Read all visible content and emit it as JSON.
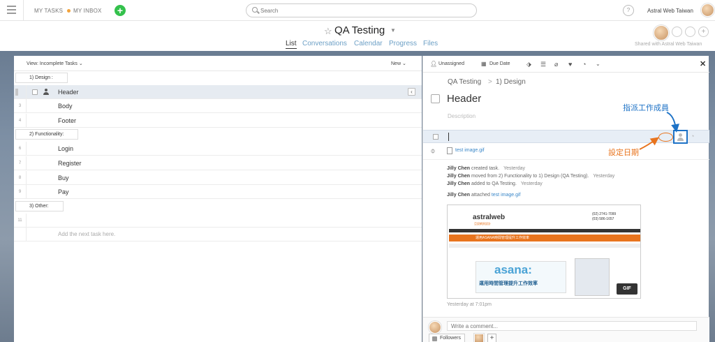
{
  "topbar": {
    "my_tasks": "MY TASKS",
    "my_inbox": "MY INBOX",
    "search_placeholder": "Search",
    "help": "?",
    "workspace": "Astral Web Taiwan"
  },
  "project": {
    "title": "QA Testing",
    "tabs": [
      {
        "label": "List",
        "active": true
      },
      {
        "label": "Conversations",
        "active": false
      },
      {
        "label": "Calendar",
        "active": false
      },
      {
        "label": "Progress",
        "active": false
      },
      {
        "label": "Files",
        "active": false
      }
    ],
    "shared_with": "Shared with Astral Web Taiwan"
  },
  "list": {
    "view_label": "View: Incomplete Tasks",
    "new_label": "New",
    "rows": [
      {
        "type": "section",
        "num": "",
        "text": "1) Design :"
      },
      {
        "type": "task",
        "num": "",
        "text": "Header",
        "selected": true
      },
      {
        "type": "task",
        "num": "3",
        "text": "Body"
      },
      {
        "type": "task",
        "num": "4",
        "text": "Footer"
      },
      {
        "type": "section",
        "num": "",
        "text": "2) Functionality:"
      },
      {
        "type": "task",
        "num": "6",
        "text": "Login"
      },
      {
        "type": "task",
        "num": "7",
        "text": "Register"
      },
      {
        "type": "task",
        "num": "8",
        "text": "Buy"
      },
      {
        "type": "task",
        "num": "9",
        "text": "Pay"
      },
      {
        "type": "section",
        "num": "",
        "text": "3) Other:"
      },
      {
        "type": "task",
        "num": "11",
        "text": ""
      },
      {
        "type": "add",
        "num": "",
        "text": "Add the next task here."
      }
    ]
  },
  "detail": {
    "toolbar": {
      "assignee": "Unassigned",
      "due_date": "Due Date"
    },
    "breadcrumb": {
      "project": "QA Testing",
      "sep": ">",
      "section": "1) Design"
    },
    "task_title": "Header",
    "description_placeholder": "Description",
    "attachment": "test image.gif",
    "stories": [
      {
        "author": "Jilly Chen",
        "text": "created task.",
        "time": "Yesterday"
      },
      {
        "author": "Jilly Chen",
        "text": "moved from 2) Functionality to 1) Design  (QA Testing).",
        "time": "Yesterday"
      },
      {
        "author": "Jilly Chen",
        "text": "added to QA Testing.",
        "time": "Yesterday"
      }
    ],
    "attached_story": {
      "author": "Jilly Chen",
      "text": "attached",
      "link": "test image.gif"
    },
    "gif": {
      "brand": "astralweb",
      "brand_sub": "亞設網頁設計",
      "phone1": "(02) 2741-7099",
      "phone2": "(03) 586-1657",
      "banner": "運用ASANA時間管理提升工作效率",
      "promo_main": "asana:",
      "promo_sub": "運用時間管理提升工作效率",
      "badge": "GIF"
    },
    "gif_timestamp": "Yesterday at 7:01pm",
    "comment_placeholder": "Write a comment...",
    "followers_label": "Followers"
  },
  "annotations": {
    "assign_note": "指派工作成員",
    "due_note": "設定日期",
    "colors": {
      "blue": "#1d72c6",
      "orange": "#e8741e"
    }
  }
}
